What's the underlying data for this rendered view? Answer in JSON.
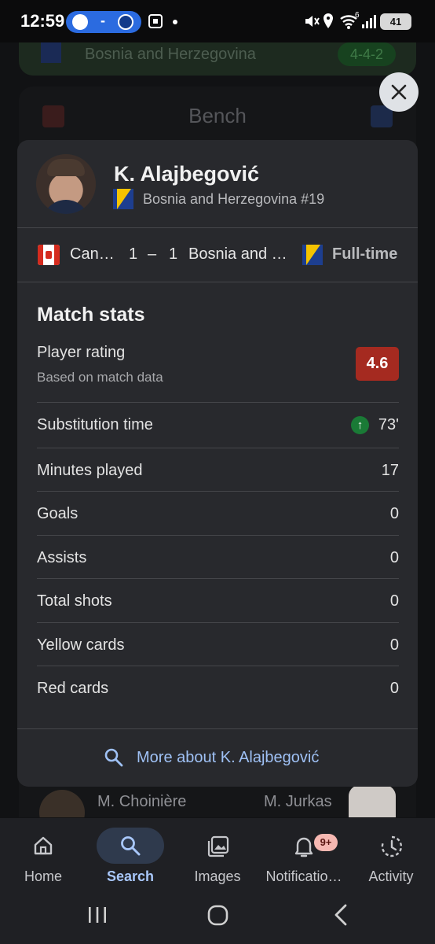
{
  "status_bar": {
    "time": "12:59",
    "pill_separator": "-",
    "signal_label": "6",
    "battery": "41"
  },
  "background": {
    "lineup_team": "Bosnia and Herzegovina",
    "lineup_formation": "4-4-2",
    "bench_title": "Bench",
    "bench_left_player": "M. Choinière",
    "bench_right_player": "M. Jurkas"
  },
  "player": {
    "name": "K. Alajbegović",
    "team_number": "Bosnia and Herzegovina #19"
  },
  "match": {
    "home_team": "Can…",
    "home_score": "1",
    "dash": "–",
    "away_score": "1",
    "away_team": "Bosnia and …",
    "status": "Full-time"
  },
  "stats": {
    "title": "Match stats",
    "rating_label": "Player rating",
    "rating_sub": "Based on match data",
    "rating_value": "4.6",
    "rating_color": "#a52a20",
    "rows": [
      {
        "label": "Substitution time",
        "value": "73'"
      },
      {
        "label": "Minutes played",
        "value": "17"
      },
      {
        "label": "Goals",
        "value": "0"
      },
      {
        "label": "Assists",
        "value": "0"
      },
      {
        "label": "Total shots",
        "value": "0"
      },
      {
        "label": "Yellow cards",
        "value": "0"
      },
      {
        "label": "Red cards",
        "value": "0"
      }
    ]
  },
  "more_link": "More about K. Alajbegović",
  "nav": {
    "items": [
      {
        "label": "Home",
        "icon": "home-icon"
      },
      {
        "label": "Search",
        "icon": "search-icon"
      },
      {
        "label": "Images",
        "icon": "images-icon"
      },
      {
        "label": "Notificatio…",
        "icon": "bell-icon"
      },
      {
        "label": "Activity",
        "icon": "activity-icon"
      }
    ],
    "notif_badge": "9+",
    "active_color": "#a8c7fa"
  }
}
